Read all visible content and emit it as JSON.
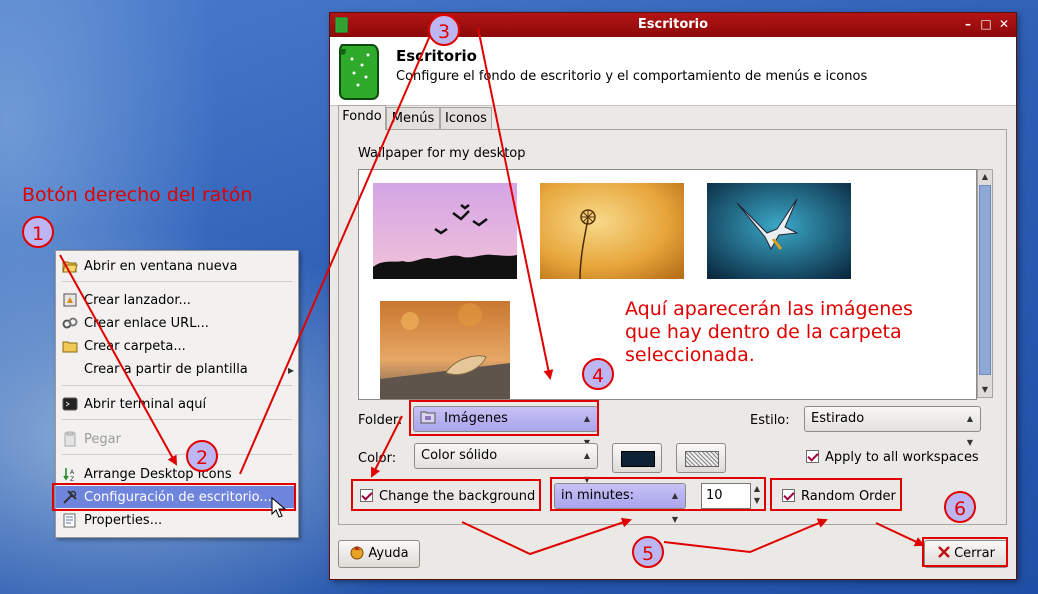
{
  "annotations": {
    "heading": "Botón derecho del ratón",
    "images_note": [
      "Aquí aparecerán las imágenes",
      "que hay dentro de la carpeta",
      "seleccionada."
    ],
    "steps": [
      "1",
      "2",
      "3",
      "4",
      "5",
      "6"
    ]
  },
  "context_menu": {
    "items": [
      {
        "label": "Abrir en ventana nueva",
        "icon": "folder-open-icon"
      },
      {
        "label": "Crear lanzador...",
        "icon": "launcher-icon"
      },
      {
        "label": "Crear enlace URL...",
        "icon": "link-icon"
      },
      {
        "label": "Crear carpeta...",
        "icon": "folder-icon"
      },
      {
        "label": "Crear a partir de plantilla",
        "icon": ""
      },
      {
        "label": "Abrir terminal aquí",
        "icon": "terminal-icon"
      },
      {
        "label": "Pegar",
        "icon": "paste-icon"
      },
      {
        "label": "Arrange Desktop Icons",
        "icon": "sort-icon"
      },
      {
        "label": "Configuración de escritorio...",
        "icon": "tools-icon"
      },
      {
        "label": "Properties...",
        "icon": "properties-icon"
      }
    ]
  },
  "dialog": {
    "window_title": "Escritorio",
    "header_title": "Escritorio",
    "header_subtitle": "Configure el fondo de escritorio y el comportamiento de menús e iconos",
    "tabs": [
      {
        "label": "Fondo",
        "active": true
      },
      {
        "label": "Menús",
        "active": false
      },
      {
        "label": "Iconos",
        "active": false
      }
    ],
    "wallpaper_label": "Wallpaper for my desktop",
    "wallpapers": [
      "birds-pink-sky",
      "dandelion-golden",
      "seagull-blue-sky",
      "autumn-leaf"
    ],
    "folder_label": "Folder:",
    "folder_value": "Imágenes",
    "style_label": "Estilo:",
    "style_value": "Estirado",
    "color_label": "Color:",
    "color_value": "Color sólido",
    "apply_all_label": "Apply to all workspaces",
    "change_bg_label": "Change the background",
    "interval_unit": "in minutes:",
    "interval_value": "10",
    "random_order_label": "Random Order",
    "help_button": "Ayuda",
    "close_button": "Cerrar",
    "colors": {
      "title_bar": "#a20f0f",
      "annotation_red": "#e00000",
      "selection": "#6e84dd",
      "swatch_primary": "#0e2236"
    }
  }
}
